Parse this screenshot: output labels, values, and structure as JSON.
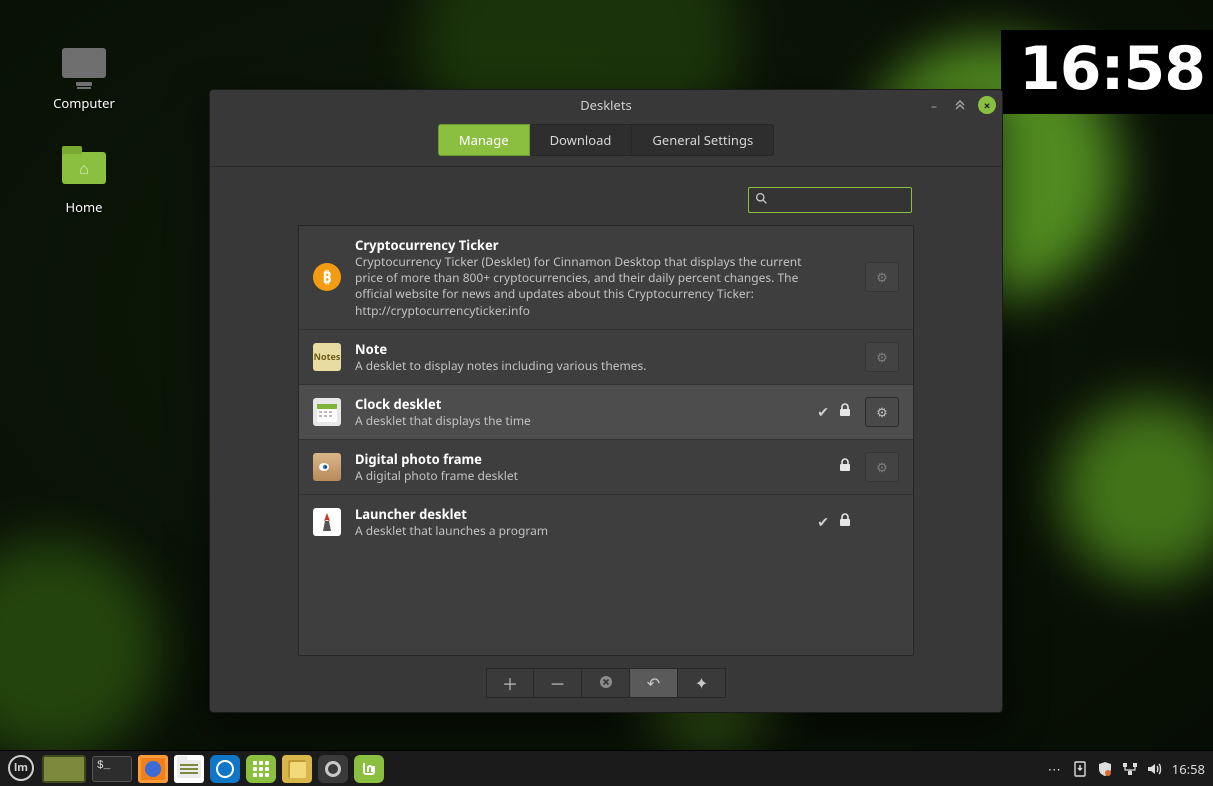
{
  "desktop": {
    "icons": [
      {
        "name": "Computer"
      },
      {
        "name": "Home"
      }
    ]
  },
  "clock_desklet": {
    "time": "16:58"
  },
  "window": {
    "title": "Desklets",
    "tabs": {
      "manage": "Manage",
      "download": "Download",
      "general": "General Settings"
    },
    "search_placeholder": "",
    "items": [
      {
        "title": "Cryptocurrency Ticker",
        "desc": "Cryptocurrency Ticker (Desklet) for Cinnamon Desktop that displays the current price of more than 800+ cryptocurrencies, and their daily percent changes. The official website for news and updates about this Cryptocurrency Ticker: http://cryptocurrencyticker.info",
        "checked": false,
        "locked": false,
        "has_settings": true
      },
      {
        "title": "Note",
        "desc": "A desklet to display notes including various themes.",
        "checked": false,
        "locked": false,
        "has_settings": true
      },
      {
        "title": "Clock desklet",
        "desc": "A desklet that displays the time",
        "checked": true,
        "locked": true,
        "has_settings": true
      },
      {
        "title": "Digital photo frame",
        "desc": "A digital photo frame desklet",
        "checked": false,
        "locked": true,
        "has_settings": true
      },
      {
        "title": "Launcher desklet",
        "desc": "A desklet that launches a program",
        "checked": true,
        "locked": true,
        "has_settings": false
      }
    ],
    "selected_index": 2
  },
  "panel": {
    "clock": "16:58"
  }
}
